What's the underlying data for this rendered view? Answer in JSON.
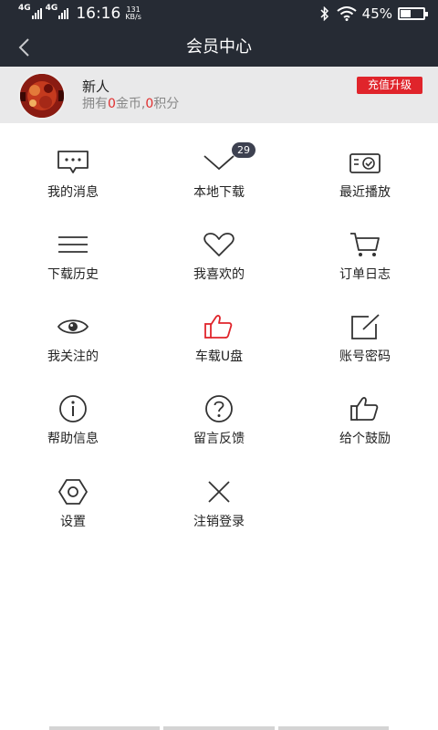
{
  "status_bar": {
    "network_1": "4G",
    "network_2": "4G",
    "time": "16:16",
    "speed_value": "131",
    "speed_unit": "KB/s",
    "battery_percent_text": "45%",
    "battery_level": 0.45,
    "icons": [
      "signal-icon",
      "bluetooth-icon",
      "wifi-icon",
      "battery-icon"
    ]
  },
  "header": {
    "title": "会员中心",
    "back_icon": "back-arrow-icon"
  },
  "profile": {
    "name": "新人",
    "stats_prefix": "拥有",
    "coins": "0",
    "coins_unit": "金币,",
    "points": "0",
    "points_unit": "积分",
    "upgrade_button": "充值升级"
  },
  "menu": [
    {
      "label": "我的消息",
      "icon": "message-icon"
    },
    {
      "label": "本地下载",
      "icon": "download-chevron-icon"
    },
    {
      "label": "最近播放",
      "icon": "recent-play-icon",
      "badge": "29"
    },
    {
      "label": "下载历史",
      "icon": "list-lines-icon"
    },
    {
      "label": "我喜欢的",
      "icon": "heart-icon"
    },
    {
      "label": "订单日志",
      "icon": "cart-icon"
    },
    {
      "label": "我关注的",
      "icon": "eye-icon"
    },
    {
      "label": "车载U盘",
      "icon": "thumbs-up-red-icon"
    },
    {
      "label": "账号密码",
      "icon": "edit-box-icon"
    },
    {
      "label": "帮助信息",
      "icon": "info-icon"
    },
    {
      "label": "留言反馈",
      "icon": "question-icon"
    },
    {
      "label": "给个鼓励",
      "icon": "thumbs-up-icon"
    },
    {
      "label": "设置",
      "icon": "gear-icon"
    },
    {
      "label": "注销登录",
      "icon": "close-x-icon"
    }
  ],
  "colors": {
    "header_bg": "#262b34",
    "accent_red": "#e0242b",
    "profile_bg": "#e9e9ea",
    "badge_bg": "#3d4150"
  }
}
